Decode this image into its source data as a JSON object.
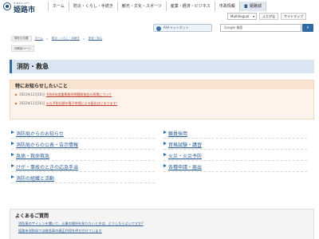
{
  "header": {
    "logo_sub": "HIMEJI CITY",
    "logo_text": "姫路市",
    "nav": [
      {
        "label": "ホーム"
      },
      {
        "label": "防災・くらし・手続き"
      },
      {
        "label": "観光・文化・スポーツ"
      },
      {
        "label": "産業・経済・ビジネス"
      },
      {
        "label": "市政情報"
      },
      {
        "label": "姫路城"
      }
    ],
    "utility": {
      "language": "Multilingual",
      "links": [
        "ふりがな",
        "サイトマップ"
      ]
    }
  },
  "search": {
    "ai_button": "AIチャットボット",
    "placeholder": "Google 検索",
    "button_icon": "search-icon"
  },
  "breadcrumb": {
    "current_label": "現在の位置",
    "items": [
      "ホーム",
      "防災・くらし・手続き",
      "安全・安心"
    ],
    "print_label": "印刷用ページ"
  },
  "page": {
    "title": "消防・救急"
  },
  "notice": {
    "title": "特にお知らせしたいこと",
    "items": [
      {
        "date": "2022年12月16日",
        "text": "令和4年度重篤救命問題勉強会の再掲について"
      },
      {
        "date": "2022年11月16日",
        "text": "火災予防分野の電子申請による届出はじまります!"
      }
    ]
  },
  "links_left": [
    "消防局からのお知らせ",
    "消防局からの公表・告示情報",
    "急病・救命救急",
    "けが・事故のときの応急手当",
    "消防の組織と活動"
  ],
  "links_right": [
    "職員採用",
    "資格試験・講習",
    "火災・火災予防",
    "各種申請・届出"
  ],
  "faq": {
    "title": "よくあるご質問",
    "items": [
      "消防車のサイレンを聞いて、火事の場所を知りたいときは、どうしたらよいですか?",
      "姫路市消防局では救急車の適正利用を呼びかけています"
    ]
  },
  "colors": {
    "accent": "#2f6aa3",
    "notice_bg": "#fdf3ea",
    "title_bg": "#d9e5f1",
    "link": "#2a5d96"
  }
}
